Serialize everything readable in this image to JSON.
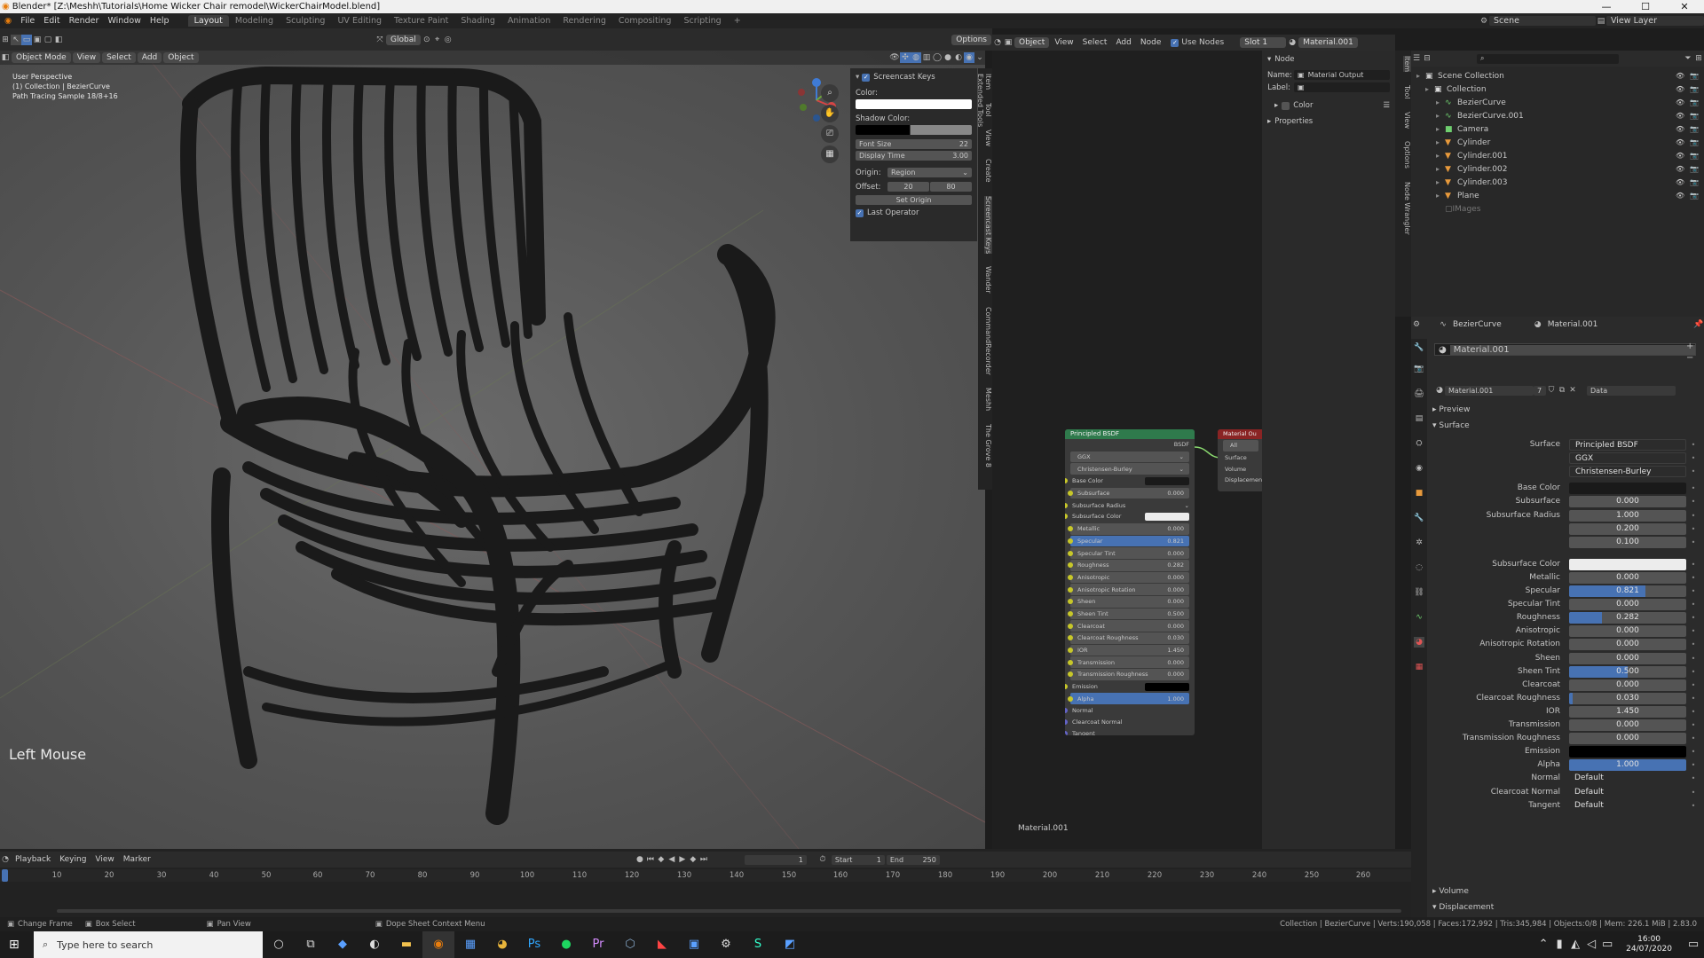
{
  "window": {
    "title": "Blender* [Z:\\Meshh\\Tutorials\\Home Wicker Chair remodel\\WickerChairModel.blend]",
    "blender_icon": "blender-icon",
    "minimize": "—",
    "maximize": "☐",
    "close": "✕"
  },
  "menu": {
    "items": [
      "File",
      "Edit",
      "Render",
      "Window",
      "Help"
    ],
    "tabs": [
      "Layout",
      "Modeling",
      "Sculpting",
      "UV Editing",
      "Texture Paint",
      "Shading",
      "Animation",
      "Rendering",
      "Compositing",
      "Scripting"
    ],
    "active_tab": "Layout",
    "add_tab": "+",
    "scene": "Scene",
    "view_layer": "View Layer"
  },
  "viewport_header": {
    "mode": "Object Mode",
    "items": [
      "View",
      "Select",
      "Add",
      "Object"
    ],
    "transform": "Global",
    "options": "Options"
  },
  "viewport": {
    "info": [
      "User Perspective",
      "(1) Collection | BezierCurve",
      "Path Tracing Sample 18/8+16"
    ],
    "screencast_text": "Left Mouse"
  },
  "screencast_panel": {
    "title": "Screencast Keys",
    "color_label": "Color:",
    "color_value": "#ffffff",
    "shadow_label": "Shadow Color:",
    "font_size_label": "Font Size",
    "font_size": "22",
    "display_time_label": "Display Time",
    "display_time": "3.00",
    "origin_label": "Origin:",
    "origin_value": "Region",
    "offset_label": "Offset:",
    "offset_x": "20",
    "offset_y": "80",
    "set_origin": "Set Origin",
    "last_operator": "Last Operator"
  },
  "n_tabs": [
    "Item",
    "Tool",
    "View",
    "Create",
    "Screencast Keys",
    "Wander",
    "CommandRecorder",
    "Meshh",
    "The Grove 8",
    "Extended Tools"
  ],
  "node_editor_header": {
    "type": "Object",
    "items": [
      "View",
      "Select",
      "Add",
      "Node"
    ],
    "use_nodes": "Use Nodes",
    "slot": "Slot 1",
    "material": "Material.001"
  },
  "node_sidebar": {
    "section": "Node",
    "name_label": "Name:",
    "name_value": "Material Output",
    "label_label": "Label:",
    "color": "Color",
    "properties": "Properties",
    "tabs": [
      "Item",
      "Tool",
      "View",
      "Options",
      "Node Wrangler"
    ]
  },
  "bsdf_node": {
    "title": "Principled BSDF",
    "output": "BSDF",
    "distribution": "GGX",
    "subsurface_method": "Christensen-Burley",
    "rows": [
      {
        "label": "Base Color",
        "value": "",
        "type": "color",
        "swatch": "#1a1a1a"
      },
      {
        "label": "Subsurface",
        "value": "0.000",
        "type": "bar"
      },
      {
        "label": "Subsurface Radius",
        "value": "",
        "type": "select"
      },
      {
        "label": "Subsurface Color",
        "value": "",
        "type": "color",
        "swatch": "#ececec"
      },
      {
        "label": "Metallic",
        "value": "0.000",
        "type": "bar"
      },
      {
        "label": "Specular",
        "value": "0.821",
        "type": "blue"
      },
      {
        "label": "Specular Tint",
        "value": "0.000",
        "type": "bar"
      },
      {
        "label": "Roughness",
        "value": "0.282",
        "type": "bar"
      },
      {
        "label": "Anisotropic",
        "value": "0.000",
        "type": "bar"
      },
      {
        "label": "Anisotropic Rotation",
        "value": "0.000",
        "type": "bar"
      },
      {
        "label": "Sheen",
        "value": "0.000",
        "type": "bar"
      },
      {
        "label": "Sheen Tint",
        "value": "0.500",
        "type": "bar"
      },
      {
        "label": "Clearcoat",
        "value": "0.000",
        "type": "bar"
      },
      {
        "label": "Clearcoat Roughness",
        "value": "0.030",
        "type": "bar"
      },
      {
        "label": "IOR",
        "value": "1.450",
        "type": "bar"
      },
      {
        "label": "Transmission",
        "value": "0.000",
        "type": "bar"
      },
      {
        "label": "Transmission Roughness",
        "value": "0.000",
        "type": "bar"
      },
      {
        "label": "Emission",
        "value": "",
        "type": "color",
        "swatch": "#000000"
      },
      {
        "label": "Alpha",
        "value": "1.000",
        "type": "blue"
      },
      {
        "label": "Normal",
        "value": "",
        "type": "plain"
      },
      {
        "label": "Clearcoat Normal",
        "value": "",
        "type": "plain"
      },
      {
        "label": "Tangent",
        "value": "",
        "type": "plain"
      }
    ]
  },
  "output_node": {
    "title": "Material Ou",
    "target": "All",
    "sockets": [
      "Surface",
      "Volume",
      "Displacement"
    ]
  },
  "node_editor_footer": "Material.001",
  "outliner": {
    "root": "Scene Collection",
    "collection": "Collection",
    "objects": [
      "BezierCurve",
      "BezierCurve.001",
      "Camera",
      "Cylinder",
      "Cylinder.001",
      "Cylinder.002",
      "Cylinder.003",
      "Plane"
    ],
    "images": "IMages"
  },
  "properties": {
    "object": "BezierCurve",
    "material": "Material.001",
    "slot_name": "Material.001",
    "users": "7",
    "link": "Data",
    "preview": "Preview",
    "surface_section": "Surface",
    "volume": "Volume",
    "displacement": "Displacement",
    "rows": [
      {
        "label": "Surface",
        "value": "Principled BSDF",
        "type": "select"
      },
      {
        "label": "",
        "value": "GGX",
        "type": "select"
      },
      {
        "label": "",
        "value": "Christensen-Burley",
        "type": "select"
      },
      {
        "label": "Base Color",
        "value": "",
        "type": "color",
        "swatch": "#1a1a1a"
      },
      {
        "label": "Subsurface",
        "value": "0.000",
        "type": "num",
        "fill": 0
      },
      {
        "label": "Subsurface Radius",
        "value": "1.000",
        "type": "num",
        "fill": 0
      },
      {
        "label": "",
        "value": "0.200",
        "type": "num",
        "fill": 0
      },
      {
        "label": "",
        "value": "0.100",
        "type": "num",
        "fill": 0
      },
      {
        "label": "Subsurface Color",
        "value": "",
        "type": "color",
        "swatch": "#ececec"
      },
      {
        "label": "Metallic",
        "value": "0.000",
        "type": "num",
        "fill": 0
      },
      {
        "label": "Specular",
        "value": "0.821",
        "type": "num",
        "fill": 0.65
      },
      {
        "label": "Specular Tint",
        "value": "0.000",
        "type": "num",
        "fill": 0
      },
      {
        "label": "Roughness",
        "value": "0.282",
        "type": "num",
        "fill": 0.282
      },
      {
        "label": "Anisotropic",
        "value": "0.000",
        "type": "num",
        "fill": 0
      },
      {
        "label": "Anisotropic Rotation",
        "value": "0.000",
        "type": "num",
        "fill": 0
      },
      {
        "label": "Sheen",
        "value": "0.000",
        "type": "num",
        "fill": 0
      },
      {
        "label": "Sheen Tint",
        "value": "0.500",
        "type": "num",
        "fill": 0.5
      },
      {
        "label": "Clearcoat",
        "value": "0.000",
        "type": "num",
        "fill": 0
      },
      {
        "label": "Clearcoat Roughness",
        "value": "0.030",
        "type": "num",
        "fill": 0.03
      },
      {
        "label": "IOR",
        "value": "1.450",
        "type": "num",
        "fill": 0
      },
      {
        "label": "Transmission",
        "value": "0.000",
        "type": "num",
        "fill": 0
      },
      {
        "label": "Transmission Roughness",
        "value": "0.000",
        "type": "num",
        "fill": 0
      },
      {
        "label": "Emission",
        "value": "",
        "type": "color",
        "swatch": "#000000"
      },
      {
        "label": "Alpha",
        "value": "1.000",
        "type": "num",
        "fill": 1
      },
      {
        "label": "Normal",
        "value": "Default",
        "type": "text"
      },
      {
        "label": "Clearcoat Normal",
        "value": "Default",
        "type": "text"
      },
      {
        "label": "Tangent",
        "value": "Default",
        "type": "text"
      }
    ]
  },
  "timeline": {
    "menus": [
      "Playback",
      "Keying",
      "View",
      "Marker"
    ],
    "current_frame": "1",
    "start_label": "Start",
    "start": "1",
    "end_label": "End",
    "end": "250",
    "ticks": [
      "10",
      "20",
      "30",
      "40",
      "50",
      "60",
      "70",
      "80",
      "90",
      "100",
      "110",
      "120",
      "130",
      "140",
      "150",
      "160",
      "170",
      "180",
      "190",
      "200",
      "210",
      "220",
      "230",
      "240",
      "250",
      "260"
    ]
  },
  "statusbar": {
    "left": [
      "Change Frame",
      "Box Select",
      "Pan View",
      "Dope Sheet Context Menu"
    ],
    "right": "Collection | BezierCurve | Verts:190,058 | Faces:172,992 | Tris:345,984 | Objects:0/8 | Mem: 226.1 MiB | 2.83.0"
  },
  "taskbar": {
    "search_placeholder": "Type here to search",
    "time": "16:00",
    "date": "24/07/2020"
  }
}
